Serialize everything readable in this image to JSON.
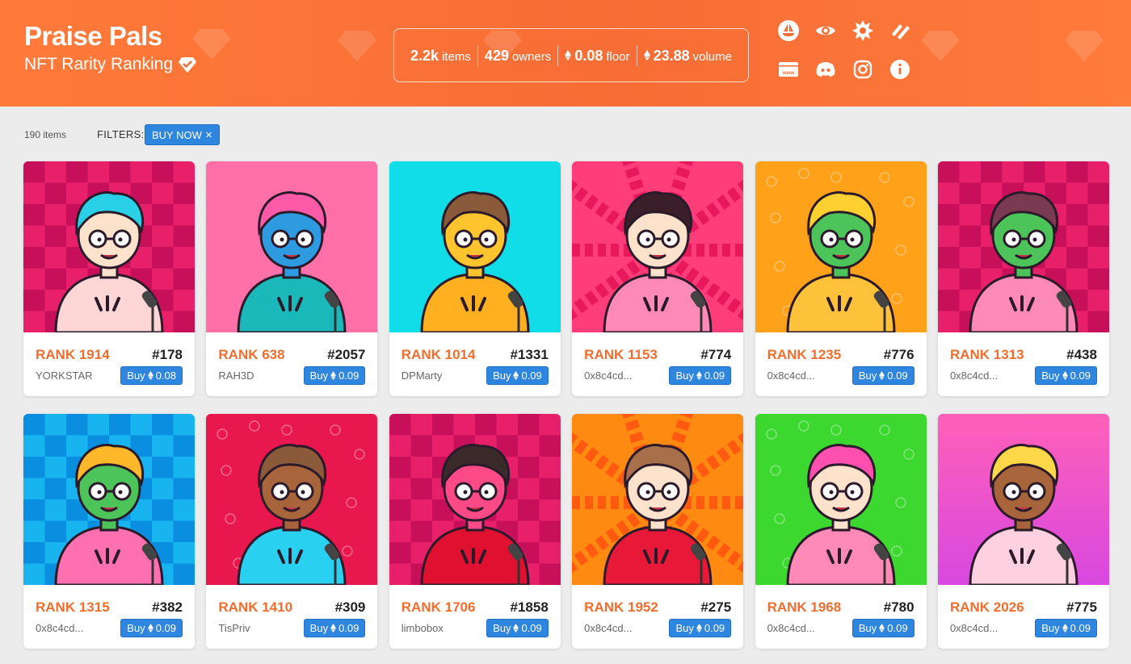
{
  "header": {
    "title": "Praise Pals",
    "subtitle": "NFT Rarity Ranking",
    "stats": [
      {
        "value": "2.2k",
        "label": "items",
        "eth": false
      },
      {
        "value": "429",
        "label": "owners",
        "eth": false
      },
      {
        "value": "0.08",
        "label": "floor",
        "eth": true
      },
      {
        "value": "23.88",
        "label": "volume",
        "eth": true
      }
    ],
    "socials": [
      "opensea-icon",
      "eye-icon",
      "splash-icon",
      "looksrare-icon",
      "website-icon",
      "discord-icon",
      "instagram-icon",
      "info-icon"
    ],
    "colors": {
      "bg": "#f76d35",
      "text": "#ffffff"
    }
  },
  "toolbar": {
    "count": "190 items",
    "filters_label": "FILTERS:",
    "chip_label": "BUY NOW",
    "chip_close": "✕"
  },
  "cards": [
    {
      "rank": "RANK 1914",
      "token": "#178",
      "owner": "YORKSTAR",
      "price": "0.08",
      "buy_label": "Buy",
      "bg": "#e8206a",
      "bg2": "#c8105a",
      "pattern": "checker",
      "skin": "#ffe2cc",
      "hair": "#2ad0e6",
      "top": "#ffd6d6"
    },
    {
      "rank": "RANK 638",
      "token": "#2057",
      "owner": "RAH3D",
      "price": "0.09",
      "buy_label": "Buy",
      "bg": "#ff70a8",
      "bg2": "#ff70a8",
      "pattern": "plain",
      "skin": "#2e9be0",
      "hair": "#ff5aa8",
      "top": "#1ab8b8"
    },
    {
      "rank": "RANK 1014",
      "token": "#1331",
      "owner": "DPMarty",
      "price": "0.09",
      "buy_label": "Buy",
      "bg": "#10dde8",
      "bg2": "#10dde8",
      "pattern": "plain",
      "skin": "#ffc42e",
      "hair": "#8a5a3a",
      "top": "#ffb020"
    },
    {
      "rank": "RANK 1153",
      "token": "#774",
      "owner": "0x8c4cd...",
      "price": "0.09",
      "buy_label": "Buy",
      "bg": "#ff3d7a",
      "bg2": "#e8185c",
      "pattern": "waves",
      "skin": "#ffe2cc",
      "hair": "#3a1e2a",
      "top": "#ff8ab8"
    },
    {
      "rank": "RANK 1235",
      "token": "#776",
      "owner": "0x8c4cd...",
      "price": "0.09",
      "buy_label": "Buy",
      "bg": "#ffa21a",
      "bg2": "#ff8a10",
      "pattern": "icons",
      "skin": "#4cc45a",
      "hair": "#ffd030",
      "top": "#ffc23a"
    },
    {
      "rank": "RANK 1313",
      "token": "#438",
      "owner": "0x8c4cd...",
      "price": "0.09",
      "buy_label": "Buy",
      "bg": "#e8206a",
      "bg2": "#c8105a",
      "pattern": "checker",
      "skin": "#4cc45a",
      "hair": "#7a3a52",
      "top": "#ff8ab8"
    },
    {
      "rank": "RANK 1315",
      "token": "#382",
      "owner": "0x8c4cd...",
      "price": "0.09",
      "buy_label": "Buy",
      "bg": "#18b4f0",
      "bg2": "#0a8ee0",
      "pattern": "checker",
      "skin": "#4cc45a",
      "hair": "#ffb82a",
      "top": "#ff70b0"
    },
    {
      "rank": "RANK 1410",
      "token": "#309",
      "owner": "TisPriv",
      "price": "0.09",
      "buy_label": "Buy",
      "bg": "#e8184e",
      "bg2": "#d0103e",
      "pattern": "icons",
      "skin": "#a8643a",
      "hair": "#8a5a3a",
      "top": "#2ad0f0"
    },
    {
      "rank": "RANK 1706",
      "token": "#1858",
      "owner": "limbobox",
      "price": "0.09",
      "buy_label": "Buy",
      "bg": "#e8206a",
      "bg2": "#c8105a",
      "pattern": "checker",
      "skin": "#ff4a88",
      "hair": "#3a2a2a",
      "top": "#e01030"
    },
    {
      "rank": "RANK 1952",
      "token": "#275",
      "owner": "0x8c4cd...",
      "price": "0.09",
      "buy_label": "Buy",
      "bg": "#ff8a12",
      "bg2": "#ff5a10",
      "pattern": "waves",
      "skin": "#ffe2cc",
      "hair": "#a8704a",
      "top": "#e81838"
    },
    {
      "rank": "RANK 1968",
      "token": "#780",
      "owner": "0x8c4cd...",
      "price": "0.09",
      "buy_label": "Buy",
      "bg": "#3cd830",
      "bg2": "#28c020",
      "pattern": "icons",
      "skin": "#ffe2cc",
      "hair": "#ff50b0",
      "top": "#ff8ab8"
    },
    {
      "rank": "RANK 2026",
      "token": "#775",
      "owner": "0x8c4cd...",
      "price": "0.09",
      "buy_label": "Buy",
      "bg": "#ff60b8",
      "bg2": "#d848e0",
      "pattern": "gradient",
      "skin": "#a8643a",
      "hair": "#ffd84a",
      "top": "#ffd0e0"
    }
  ]
}
